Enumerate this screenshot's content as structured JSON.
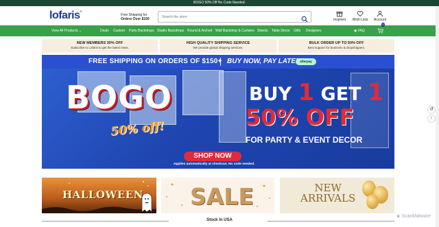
{
  "announcement": "BOGO 50% Off No Code Needed.",
  "header": {
    "logo": "lofaris",
    "shipping_line1": "Free Shipping for",
    "shipping_line2": "Orders Over $150",
    "search_placeholder": "Search the store",
    "inspired_label": "Inspired",
    "wishlist_label": "Wish Lists",
    "account_label": "Account"
  },
  "nav": {
    "all_products": "View All Products",
    "items": [
      "Deals",
      "Custom",
      "Party Backdrops",
      "Studio Backdrops",
      "Round & Arched",
      "Wall Backdrop & Curtains",
      "Stands",
      "Table Decor",
      "Gifts",
      "Designers"
    ],
    "faq": "FAQ",
    "cart_count": "0"
  },
  "features": [
    {
      "title": "NEW MEMBERS 30% OFF",
      "subtitle": "Subscribe to Lofaris to get the latest news."
    },
    {
      "title": "HIGH QUALITY SHIPPING SERVICE",
      "subtitle": "We provide global shipping services."
    },
    {
      "title": "BULK ORDER UP TO 50% OFF",
      "subtitle": "Best support for business & dropshippers."
    }
  ],
  "hero": {
    "banner_left": "FREE SHIPPING ON ORDERS OF $150+",
    "banner_right": "BUY NOW, PAY LATER",
    "banner_badge": "afterpay",
    "bogo": "BOGO",
    "bogo_sub": "50% off!",
    "buy_a": "BUY ",
    "buy_one_a": "1",
    "buy_b": " GET ",
    "buy_one_b": "1",
    "off": "50% OFF",
    "decor": "FOR PARTY & EVENT DECOR",
    "shop_now": "SHOP NOW",
    "note": "Applies automatically at checkout. No code needed."
  },
  "categories": {
    "halloween": "HALLOWEEN",
    "sale": "SALE",
    "new_line1": "NEW",
    "new_line2": "ARRIVALS"
  },
  "stock_heading": "Stock In USA",
  "watermark": "ScanMalware",
  "colors": {
    "nav_green": "#3aa14a",
    "topbar": "#1c4533",
    "hero_blue": "#1d3ea8",
    "accent_red": "#e02b3a"
  }
}
